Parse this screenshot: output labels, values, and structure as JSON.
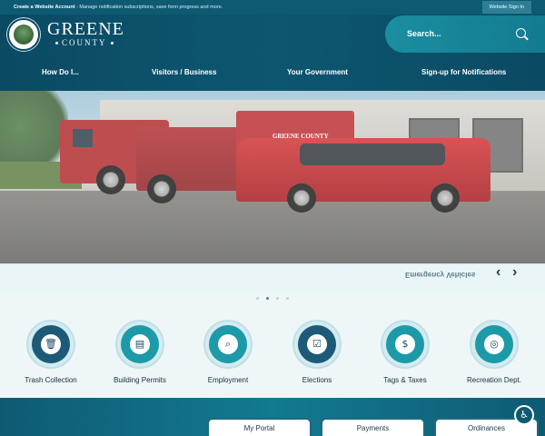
{
  "topbar": {
    "create_account": "Create a Website Account",
    "create_account_desc": " - Manage notification subscriptions, save form progress and more.",
    "sign_in": "Website Sign In"
  },
  "brand": {
    "name": "GREENE",
    "subtitle": "COUNTY"
  },
  "search": {
    "placeholder": "Search..."
  },
  "nav": {
    "items": [
      {
        "label": "How Do I..."
      },
      {
        "label": "Visitors / Business"
      },
      {
        "label": "Your Government"
      },
      {
        "label": "Sign-up for Notifications"
      }
    ]
  },
  "hero": {
    "vehicle_lettering": "GREENE COUNTY",
    "caption": "Emergency Vehicles",
    "prev_arrow": "‹",
    "next_arrow": "›",
    "slide_count": 4,
    "active_slide": 2
  },
  "quick_links": [
    {
      "label": "Trash Collection",
      "icon": "trash-icon",
      "glyph": "🗑",
      "color": "#1d5a78"
    },
    {
      "label": "Building Permits",
      "icon": "document-icon",
      "glyph": "▤",
      "color": "#1d9aa8"
    },
    {
      "label": "Employment",
      "icon": "briefcase-icon",
      "glyph": "⌕",
      "color": "#1d9aa8"
    },
    {
      "label": "Elections",
      "icon": "ballot-icon",
      "glyph": "☑",
      "color": "#1d5a78"
    },
    {
      "label": "Tags & Taxes",
      "icon": "tag-icon",
      "glyph": "$",
      "color": "#1d9aa8"
    },
    {
      "label": "Recreation Dept.",
      "icon": "ball-icon",
      "glyph": "◎",
      "color": "#1d9aa8"
    }
  ],
  "bottom_cards": [
    {
      "label": "My Portal"
    },
    {
      "label": "Payments"
    },
    {
      "label": "Ordinances"
    }
  ],
  "accessibility": {
    "icon": "accessibility-icon",
    "glyph": "♿"
  },
  "colors": {
    "header": "#0b4a63",
    "accent": "#1d9aa8",
    "dark_accent": "#1d5a78"
  }
}
